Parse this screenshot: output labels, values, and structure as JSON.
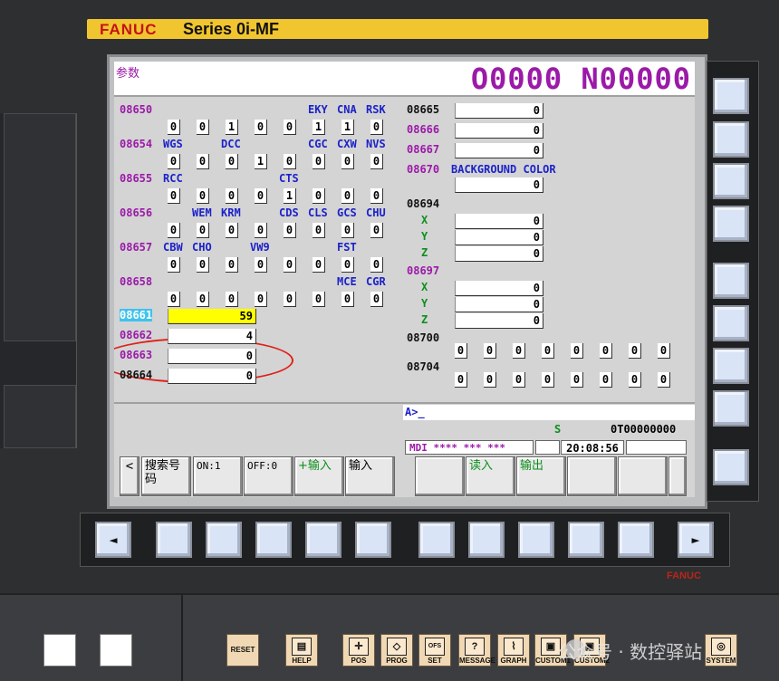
{
  "banner": {
    "brand": "FANUC",
    "series": "Series 0i-MF"
  },
  "screen": {
    "title": "参数",
    "program": "O0000 N00000"
  },
  "params_left": [
    {
      "no": "08650",
      "labels": [
        "",
        "",
        "",
        "",
        "",
        "EKY",
        "CNA",
        "RSK"
      ],
      "bits": [
        "0",
        "0",
        "1",
        "0",
        "0",
        "1",
        "1",
        "0"
      ]
    },
    {
      "no": "08654",
      "labels": [
        "WGS",
        "",
        "DCC",
        "",
        "",
        "CGC",
        "CXW",
        "NVS"
      ],
      "bits": [
        "0",
        "0",
        "0",
        "1",
        "0",
        "0",
        "0",
        "0"
      ]
    },
    {
      "no": "08655",
      "labels": [
        "RCC",
        "",
        "",
        "",
        "CTS",
        "",
        "",
        ""
      ],
      "bits": [
        "0",
        "0",
        "0",
        "0",
        "1",
        "0",
        "0",
        "0"
      ]
    },
    {
      "no": "08656",
      "labels": [
        "",
        "WEM",
        "KRM",
        "",
        "CDS",
        "CLS",
        "GCS",
        "CHU"
      ],
      "bits": [
        "0",
        "0",
        "0",
        "0",
        "0",
        "0",
        "0",
        "0"
      ]
    },
    {
      "no": "08657",
      "labels": [
        "CBW",
        "CHO",
        "",
        "VW9",
        "",
        "",
        "FST",
        ""
      ],
      "bits": [
        "0",
        "0",
        "0",
        "0",
        "0",
        "0",
        "0",
        "0"
      ]
    },
    {
      "no": "08658",
      "labels": [
        "",
        "",
        "",
        "",
        "",
        "",
        "MCE",
        "CGR"
      ],
      "bits": [
        "0",
        "0",
        "0",
        "0",
        "0",
        "0",
        "0",
        "0"
      ]
    }
  ],
  "params_value_left": [
    {
      "no": "08661",
      "value": "59"
    },
    {
      "no": "08662",
      "value": "4"
    },
    {
      "no": "08663",
      "value": "0"
    },
    {
      "no": "08664",
      "value": "0"
    }
  ],
  "params_right": {
    "p8665": {
      "no": "08665",
      "value": "0"
    },
    "p8666": {
      "no": "08666",
      "value": "0"
    },
    "p8667": {
      "no": "08667",
      "value": "0"
    },
    "p8670": {
      "no": "08670",
      "label": "BACKGROUND COLOR",
      "value": "0"
    },
    "p8694": {
      "no": "08694",
      "axes": [
        {
          "ax": "X",
          "value": "0"
        },
        {
          "ax": "Y",
          "value": "0"
        },
        {
          "ax": "Z",
          "value": "0"
        }
      ]
    },
    "p8697": {
      "no": "08697",
      "axes": [
        {
          "ax": "X",
          "value": "0"
        },
        {
          "ax": "Y",
          "value": "0"
        },
        {
          "ax": "Z",
          "value": "0"
        }
      ]
    },
    "p8700": {
      "no": "08700",
      "bits": [
        "0",
        "0",
        "0",
        "0",
        "0",
        "0",
        "0",
        "0"
      ]
    },
    "p8704": {
      "no": "08704",
      "bits": [
        "0",
        "0",
        "0",
        "0",
        "0",
        "0",
        "0",
        "0"
      ]
    }
  },
  "status": {
    "prompt": "A>_",
    "s": "S",
    "t": "0T00000000",
    "mode": "MDI  **** *** ***",
    "time": "20:08:56"
  },
  "softkeys": [
    "搜索号码",
    "ON:1",
    "OFF:0",
    "+输入",
    "输入",
    "",
    "读入",
    "输出",
    "",
    ""
  ],
  "mdi_keys": {
    "reset": "RESET",
    "help": "HELP",
    "pos": "POS",
    "prog": "PROG",
    "set": "SET",
    "ofs": "OFS",
    "message": "MESSAGE",
    "graph": "GRAPH",
    "custom1": "CUSTOM1",
    "custom2": "CUSTOM2",
    "system": "SYSTEM"
  },
  "icons": {
    "left_arrow": "◄",
    "right_arrow": "►",
    "page_prev": "<"
  },
  "fanuc_small": "FANUC",
  "watermark": "公众号 · 数控驿站",
  "colors": {
    "param_no": "#9b1aa8",
    "bit_label": "#1c22c9",
    "axis": "#0d8f1c",
    "highlight": "#ffff00",
    "accent_red": "#e0201a"
  }
}
